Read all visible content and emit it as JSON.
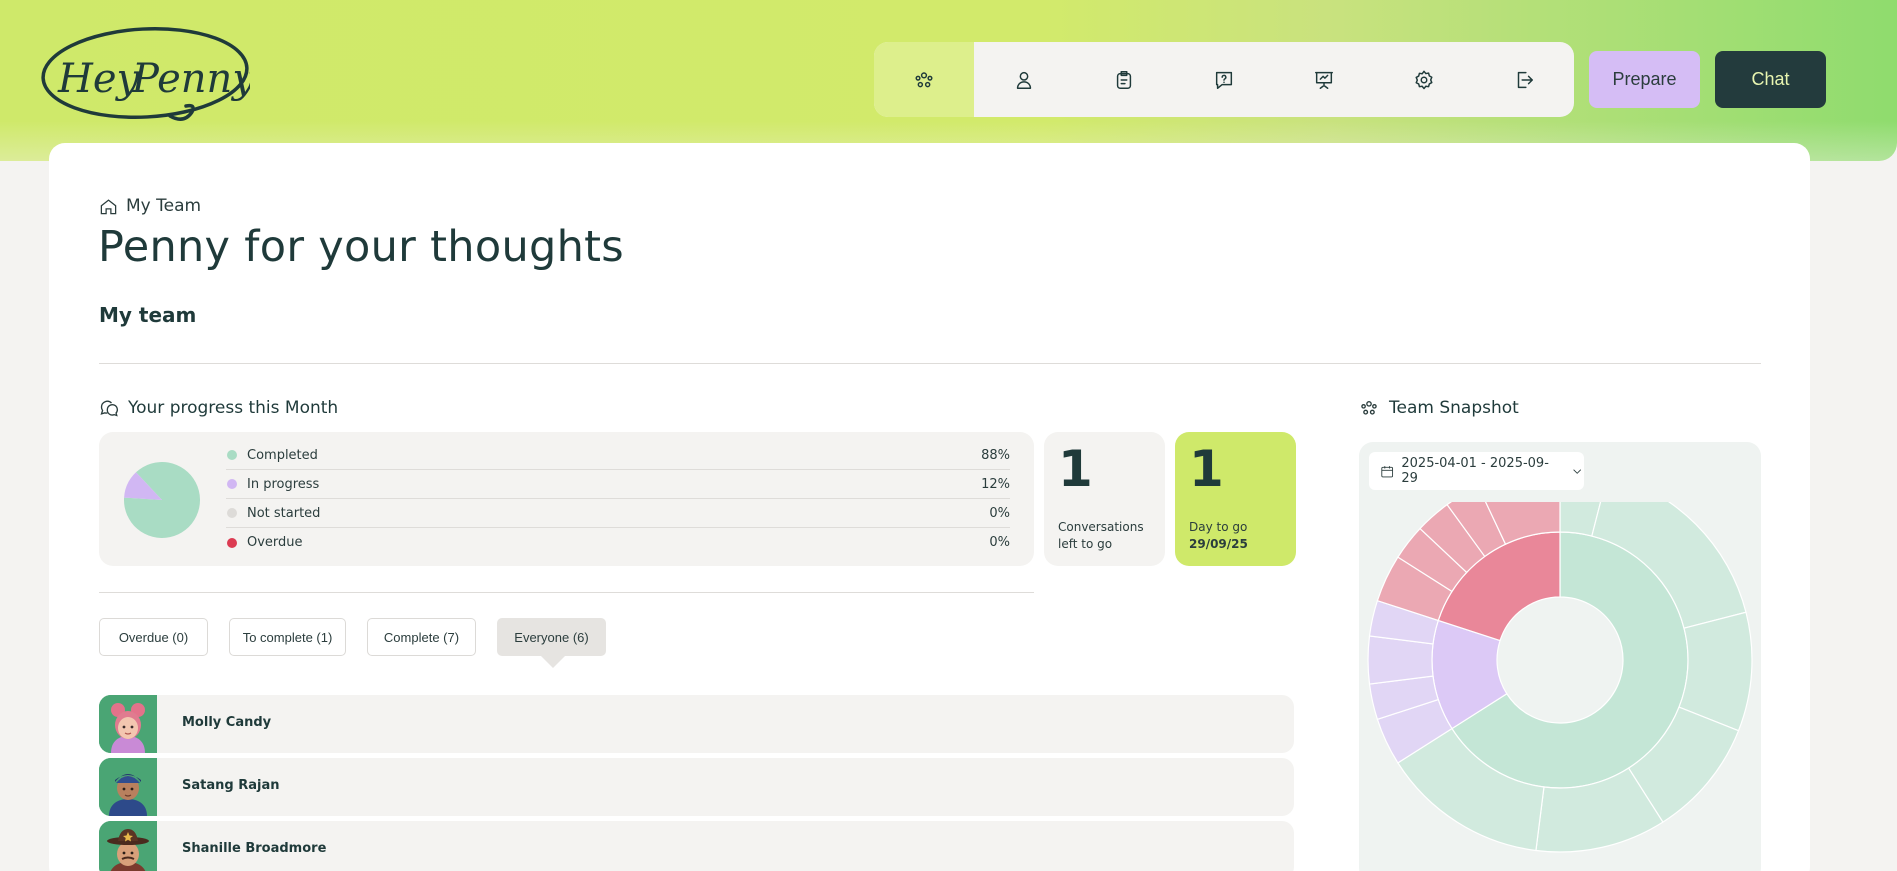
{
  "brand": {
    "logo_text": "Hey Penny"
  },
  "nav": {
    "icons": [
      "team-icon",
      "user-icon",
      "clipboard-icon",
      "question-chat-icon",
      "presentation-icon",
      "gear-icon",
      "logout-icon"
    ],
    "prepare_label": "Prepare",
    "chat_label": "Chat"
  },
  "breadcrumb": {
    "label": "My Team"
  },
  "page": {
    "title": "Penny for your thoughts",
    "section_title": "My team"
  },
  "progress": {
    "heading": "Your progress this Month",
    "rows": [
      {
        "label": "Completed",
        "value": "88%",
        "color": "#a9dcc4"
      },
      {
        "label": "In progress",
        "value": "12%",
        "color": "#d1b7f3"
      },
      {
        "label": "Not started",
        "value": "0%",
        "color": "#dddbd8"
      },
      {
        "label": "Overdue",
        "value": "0%",
        "color": "#dc3b52"
      }
    ],
    "pie_fractions": [
      0.88,
      0.12,
      0,
      0
    ],
    "conversations": {
      "number": "1",
      "caption_line1": "Conversations",
      "caption_line2": "left to go"
    },
    "days": {
      "number": "1",
      "caption_line1": "Day to go",
      "date": "29/09/25"
    }
  },
  "filters": [
    {
      "label": "Overdue (0)",
      "active": false
    },
    {
      "label": "To complete (1)",
      "active": false
    },
    {
      "label": "Complete (7)",
      "active": false
    },
    {
      "label": "Everyone (6)",
      "active": true
    }
  ],
  "team": [
    {
      "name": "Molly Candy",
      "avatar": "avatar-pink-hair"
    },
    {
      "name": "Satang Rajan",
      "avatar": "avatar-blue-cap"
    },
    {
      "name": "Shanille Broadmore",
      "avatar": "avatar-cowboy-hat"
    }
  ],
  "snapshot": {
    "heading": "Team Snapshot",
    "date_range": "2025-04-01 - 2025-09-29",
    "colors": {
      "completed": "#c4e6d6",
      "in_progress": "#dcc9f6",
      "overdue": "#e98799"
    }
  }
}
